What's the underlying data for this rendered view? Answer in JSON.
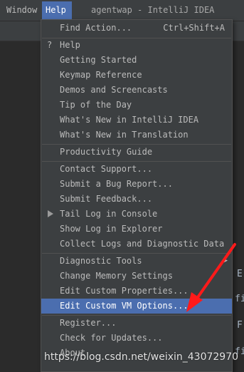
{
  "menubar": {
    "window_label": "Window",
    "help_label": "Help",
    "title": "agentwap - IntelliJ IDEA"
  },
  "background_text": {
    "e1": "E",
    "fi": "fi",
    "f2": "F",
    "fi2": "fi"
  },
  "help_menu": {
    "items": [
      {
        "label": "Find Action...",
        "shortcut": "Ctrl+Shift+A"
      },
      {
        "label": "Help",
        "lead": "?"
      },
      {
        "label": "Getting Started"
      },
      {
        "label": "Keymap Reference"
      },
      {
        "label": "Demos and Screencasts"
      },
      {
        "label": "Tip of the Day"
      },
      {
        "label": "What's New in IntelliJ IDEA"
      },
      {
        "label": "What's New in Translation"
      },
      {
        "label": "Productivity Guide"
      },
      {
        "label": "Contact Support..."
      },
      {
        "label": "Submit a Bug Report..."
      },
      {
        "label": "Submit Feedback..."
      },
      {
        "label": "Tail Log in Console"
      },
      {
        "label": "Show Log in Explorer"
      },
      {
        "label": "Collect Logs and Diagnostic Data"
      },
      {
        "label": "Diagnostic Tools"
      },
      {
        "label": "Change Memory Settings"
      },
      {
        "label": "Edit Custom Properties..."
      },
      {
        "label": "Edit Custom VM Options...",
        "selected": true
      },
      {
        "label": "Register..."
      },
      {
        "label": "Check for Updates..."
      },
      {
        "label": "About"
      }
    ]
  },
  "watermark": "https://blog.csdn.net/weixin_43072970",
  "colors": {
    "selection": "#4b6eaf",
    "menu_bg": "#3c3f41",
    "annotation_arrow": "#ff1a1a"
  }
}
